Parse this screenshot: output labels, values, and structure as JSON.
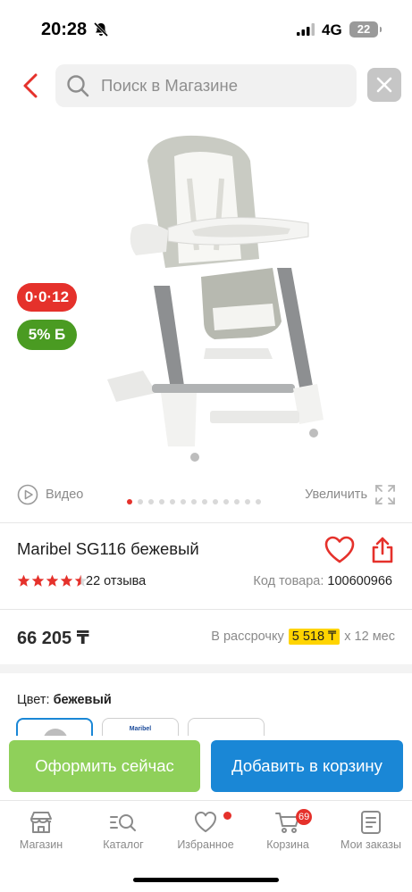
{
  "status_bar": {
    "time": "20:28",
    "network": "4G",
    "battery": "22"
  },
  "search": {
    "placeholder": "Поиск в Магазине"
  },
  "badges": {
    "installment": "0·0·12",
    "bonus": "5% Б"
  },
  "media": {
    "video_label": "Видео",
    "zoom_label": "Увеличить",
    "dots_count": 13,
    "active_dot": 0
  },
  "product": {
    "title": "Maribel SG116 бежевый",
    "rating": 4.5,
    "reviews": "22 отзыва",
    "code_label": "Код товара:",
    "code_value": "100600966",
    "price": "66 205 ₸",
    "installment_prefix": "В рассрочку",
    "installment_amount": "5 518 ₸",
    "installment_suffix": "x 12 мес",
    "color_label": "Цвет:",
    "color_value": "бежевый",
    "swatch_brand_text": "Maribel"
  },
  "actions": {
    "checkout_label": "Оформить сейчас",
    "cart_label": "Добавить в корзину"
  },
  "nav": {
    "items": [
      {
        "label": "Магазин",
        "icon": "shop-icon"
      },
      {
        "label": "Каталог",
        "icon": "catalog-search-icon"
      },
      {
        "label": "Избранное",
        "icon": "heart-icon"
      },
      {
        "label": "Корзина",
        "icon": "cart-icon"
      },
      {
        "label": "Мои заказы",
        "icon": "orders-icon"
      }
    ],
    "cart_badge": "69"
  },
  "colors": {
    "accent_red": "#e5312b",
    "accent_blue": "#1a87d6",
    "accent_green": "#8fd05a",
    "bonus_green": "#4a9b22",
    "installment_yellow": "#ffd400"
  }
}
